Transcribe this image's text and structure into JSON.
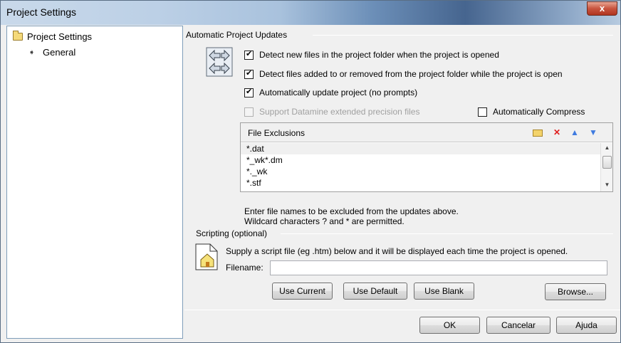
{
  "window": {
    "title": "Project Settings",
    "close_label": "x"
  },
  "tree": {
    "root_label": "Project Settings",
    "child_label": "General"
  },
  "auto_updates": {
    "group_label": "Automatic Project Updates",
    "options": [
      {
        "label": "Detect new files in the project folder when the project is opened",
        "checked": true,
        "disabled": false
      },
      {
        "label": "Detect files added to or removed from the project folder while the project is open",
        "checked": true,
        "disabled": false
      },
      {
        "label": "Automatically update project (no prompts)",
        "checked": true,
        "disabled": false
      },
      {
        "label": "Support Datamine extended precision files",
        "checked": false,
        "disabled": true
      }
    ],
    "auto_compress_label": "Automatically Compress",
    "auto_compress_checked": false
  },
  "exclusions": {
    "title": "File Exclusions",
    "items": [
      "*.dat",
      "*_wk*.dm",
      "*._wk",
      "*.stf"
    ],
    "selected_index": 0,
    "help_line1": "Enter file names to be excluded from the updates above.",
    "help_line2": "Wildcard characters ? and * are permitted."
  },
  "scripting": {
    "group_label": "Scripting (optional)",
    "description": "Supply a script file (eg .htm) below and it will be displayed each time the project is opened.",
    "filename_label": "Filename:",
    "filename_value": "",
    "use_current": "Use Current",
    "use_default": "Use Default",
    "use_blank": "Use Blank",
    "browse": "Browse..."
  },
  "footer": {
    "ok": "OK",
    "cancel": "Cancelar",
    "help": "Ajuda"
  }
}
